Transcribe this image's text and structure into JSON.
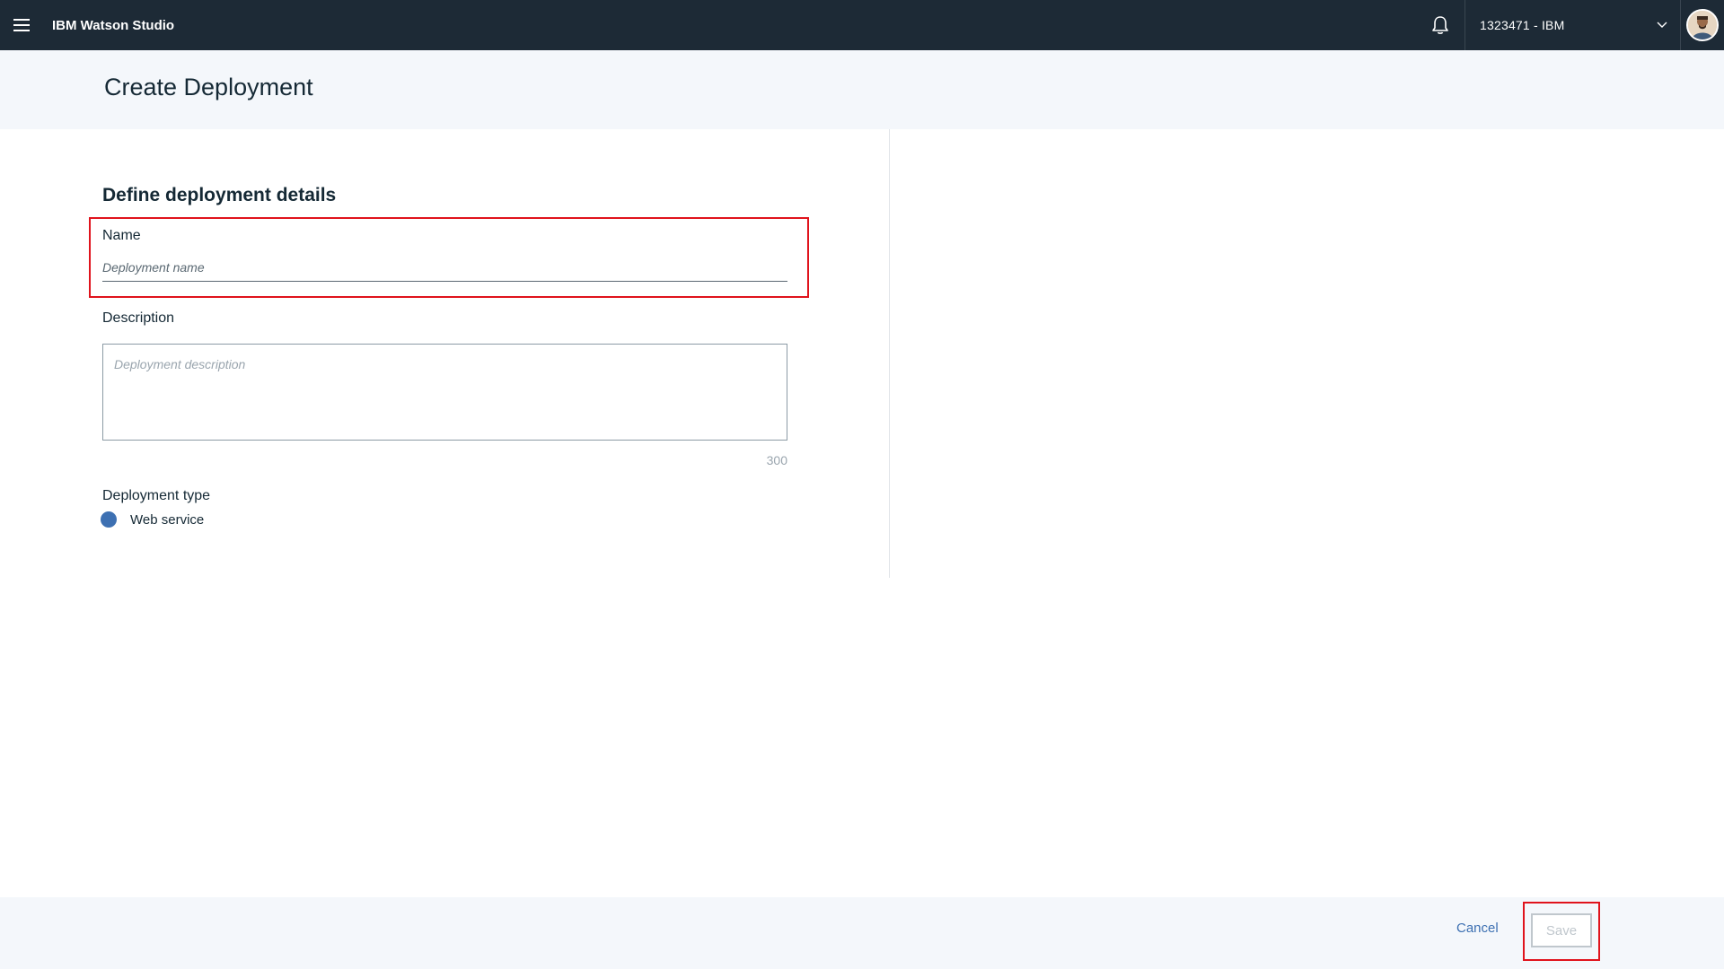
{
  "app": {
    "title": "IBM Watson Studio"
  },
  "topbar": {
    "account_label": "1323471 - IBM"
  },
  "page": {
    "title": "Create Deployment"
  },
  "form": {
    "section_title": "Define deployment details",
    "name": {
      "label": "Name",
      "placeholder": "Deployment name",
      "value": ""
    },
    "description": {
      "label": "Description",
      "placeholder": "Deployment description",
      "value": "",
      "char_limit": "300"
    },
    "deployment_type": {
      "label": "Deployment type",
      "selected_option": "Web service"
    }
  },
  "footer": {
    "cancel_label": "Cancel",
    "save_label": "Save"
  },
  "icons": {
    "menu": "hamburger-menu-icon",
    "notifications": "bell-icon",
    "account_dropdown": "chevron-down-icon",
    "user": "avatar"
  },
  "colors": {
    "topbar_bg": "#1d2a36",
    "header_bg": "#f4f7fb",
    "accent": "#3d70b2",
    "highlight": "#e0131c"
  }
}
